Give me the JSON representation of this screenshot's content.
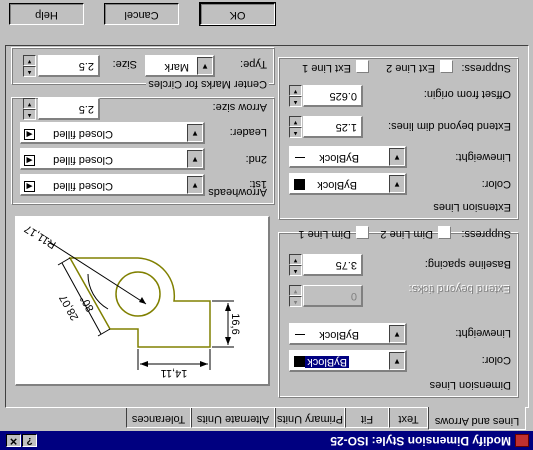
{
  "window": {
    "title": "Modify Dimension Style: ISO-25"
  },
  "tabs": [
    "Lines and Arrows",
    "Text",
    "Fit",
    "Primary Units",
    "Alternate Units",
    "Tolerances"
  ],
  "dimension_lines": {
    "group_label": "Dimension Lines",
    "color_label": "Color:",
    "color_value": "ByBlock",
    "lineweight_label": "Lineweight:",
    "lineweight_value": "ByBlock",
    "extend_label": "Extend beyond ticks:",
    "extend_value": "0",
    "baseline_label": "Baseline spacing:",
    "baseline_value": "3.75",
    "suppress_label": "Suppress:",
    "dim_line1": "Dim Line 1",
    "dim_line2": "Dim Line 2"
  },
  "extension_lines": {
    "group_label": "Extension Lines",
    "color_label": "Color:",
    "color_value": "ByBlock",
    "lineweight_label": "Lineweight:",
    "lineweight_value": "ByBlock",
    "extend_label": "Extend beyond dim lines:",
    "extend_value": "1.25",
    "offset_label": "Offset from origin:",
    "offset_value": "0.625",
    "suppress_label": "Suppress:",
    "ext_line1": "Ext Line 1",
    "ext_line2": "Ext Line 2"
  },
  "arrowheads": {
    "group_label": "Arrowheads",
    "first_label": "1st:",
    "first_value": "Closed filled",
    "second_label": "2nd:",
    "second_value": "Closed filled",
    "leader_label": "Leader:",
    "leader_value": "Closed filled",
    "size_label": "Arrow size:",
    "size_value": "2.5"
  },
  "center_marks": {
    "group_label": "Center Marks for Circles",
    "type_label": "Type:",
    "type_value": "Mark",
    "size_label": "Size:",
    "size_value": "2.5"
  },
  "preview": {
    "dim_top": "14,11",
    "dim_left": "16,6",
    "dim_diag": "28,07",
    "dim_angle": "80°",
    "dim_radius": "R11,17"
  },
  "buttons": {
    "ok": "OK",
    "cancel": "Cancel",
    "help": "Help"
  },
  "colors": {
    "titlebar": "#000080",
    "face": "#c0c0c0",
    "preview_outline": "#808000"
  }
}
